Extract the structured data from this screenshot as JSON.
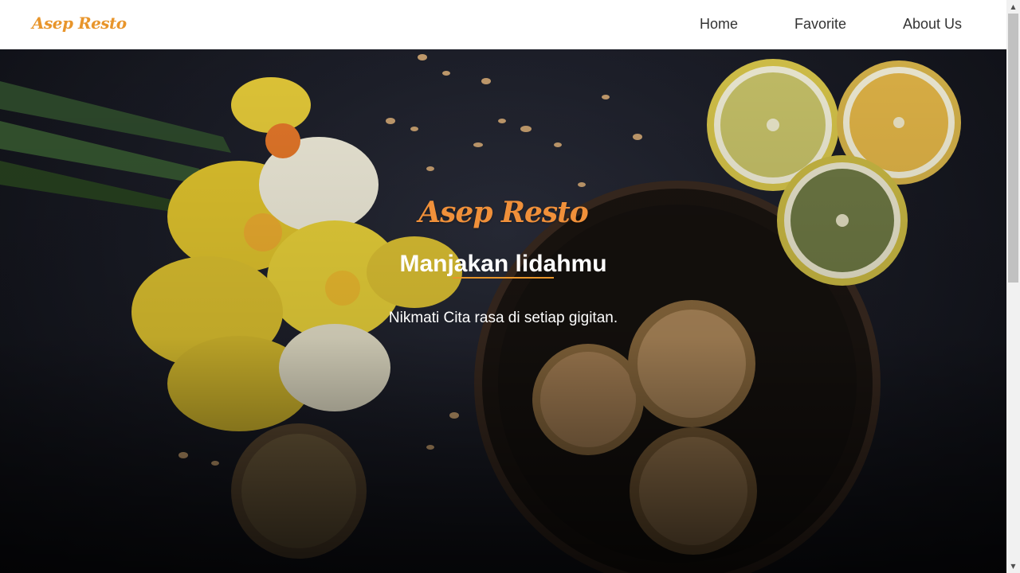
{
  "brand": {
    "name": "Asep Resto"
  },
  "nav": {
    "items": [
      {
        "label": "Home"
      },
      {
        "label": "Favorite"
      },
      {
        "label": "About Us"
      }
    ]
  },
  "hero": {
    "title": "Asep Resto",
    "subtitle": "Manjakan lidahmu",
    "tagline": "Nikmati Cita rasa di setiap gigitan."
  },
  "colors": {
    "accent": "#e8952b",
    "hero_title": "#f0903a",
    "nav_bg": "#ffffff",
    "nav_text": "#333333"
  },
  "icons": {
    "scroll_up": "triangle-up-icon",
    "scroll_down": "triangle-down-icon"
  }
}
